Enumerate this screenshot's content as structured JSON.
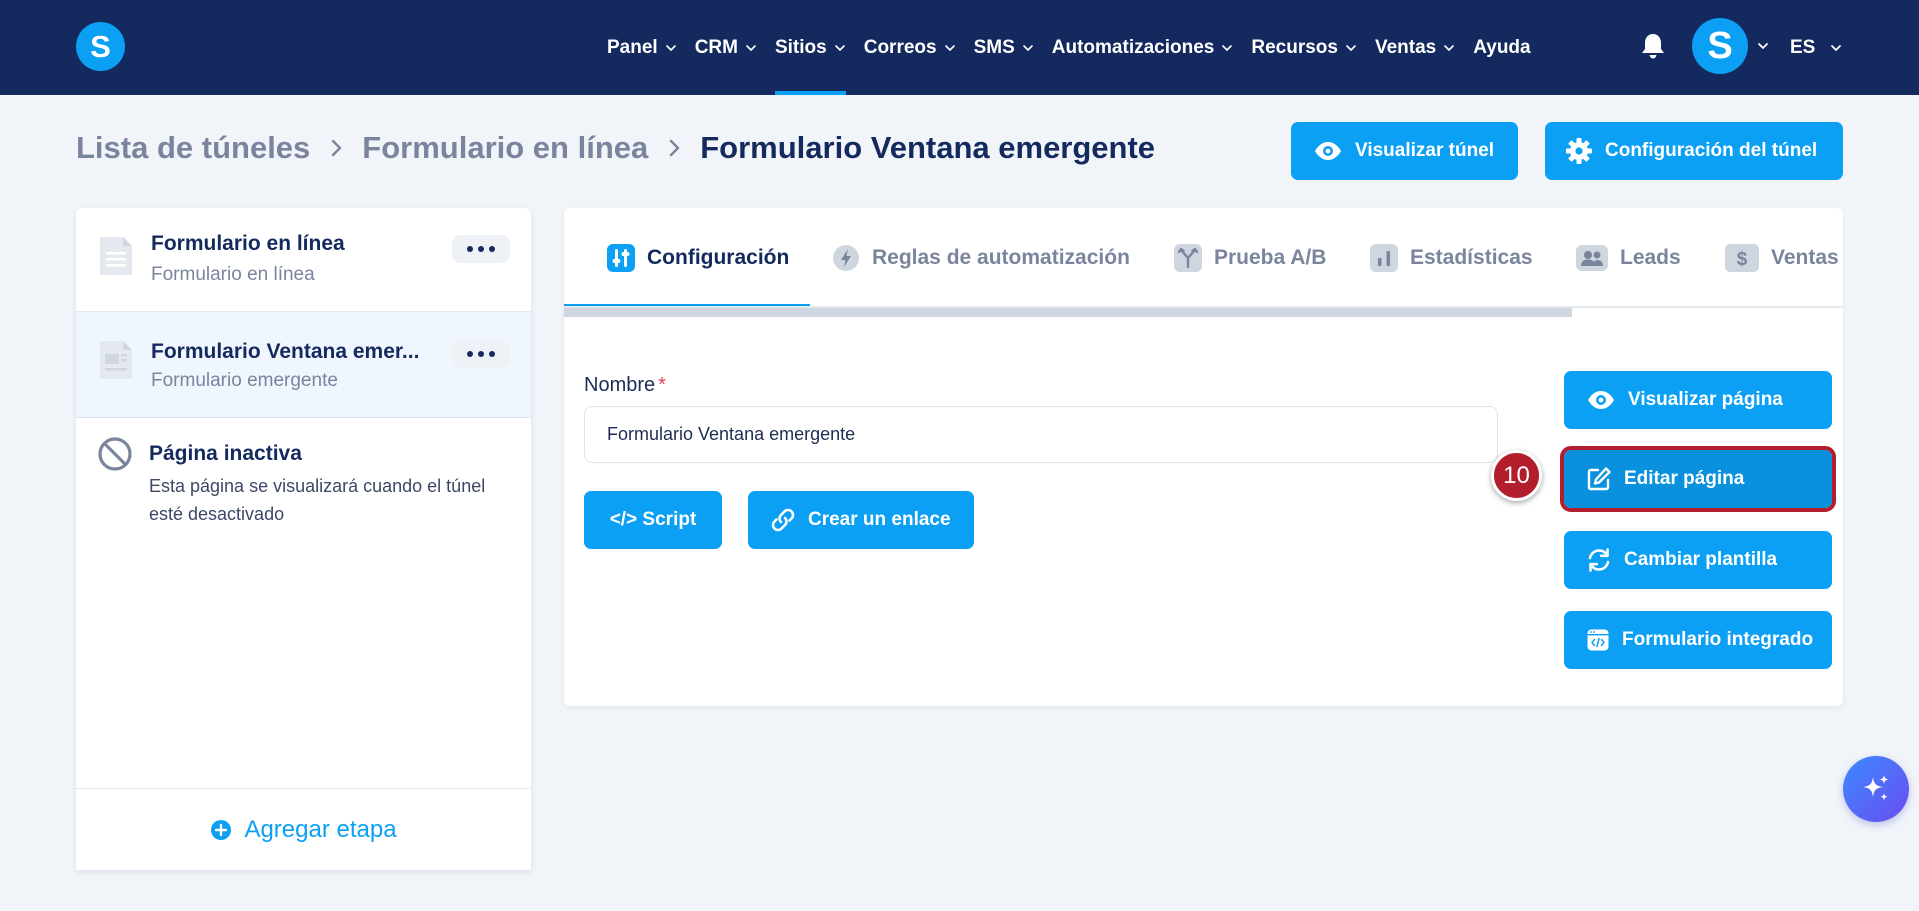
{
  "app": {
    "logo_letter": "S",
    "avatar_letter": "S"
  },
  "nav": {
    "items": [
      {
        "label": "Panel",
        "dropdown": true
      },
      {
        "label": "CRM",
        "dropdown": true
      },
      {
        "label": "Sitios",
        "dropdown": true,
        "active": true
      },
      {
        "label": "Correos",
        "dropdown": true
      },
      {
        "label": "SMS",
        "dropdown": true
      },
      {
        "label": "Automatizaciones",
        "dropdown": true
      },
      {
        "label": "Recursos",
        "dropdown": true
      },
      {
        "label": "Ventas",
        "dropdown": true
      },
      {
        "label": "Ayuda",
        "dropdown": false
      }
    ],
    "language": "ES"
  },
  "breadcrumb": {
    "items": [
      "Lista de túneles",
      "Formulario en línea",
      "Formulario Ventana emergente"
    ]
  },
  "header_actions": {
    "preview_tunnel": "Visualizar túnel",
    "tunnel_settings": "Configuración del túnel"
  },
  "steps": {
    "items": [
      {
        "title": "Formulario en línea",
        "subtitle": "Formulario en línea"
      },
      {
        "title": "Formulario Ventana emer...",
        "subtitle": "Formulario emergente"
      }
    ],
    "inactive": {
      "title": "Página inactiva",
      "description": "Esta página se visualizará cuando el túnel esté desactivado"
    },
    "add_label": "Agregar etapa"
  },
  "tabs": {
    "items": [
      {
        "label": "Configuración",
        "active": true
      },
      {
        "label": "Reglas de automatización"
      },
      {
        "label": "Prueba A/B"
      },
      {
        "label": "Estadísticas"
      },
      {
        "label": "Leads"
      },
      {
        "label": "Ventas"
      }
    ]
  },
  "form": {
    "name_label": "Nombre",
    "required_mark": "*",
    "name_value": "Formulario Ventana emergente",
    "script_button": "</> Script",
    "link_button": "Crear un enlace"
  },
  "page_actions": {
    "preview_page": "Visualizar página",
    "edit_page": "Editar página",
    "change_template": "Cambiar plantilla",
    "embedded_form": "Formulario integrado"
  },
  "step_badge": "10",
  "colors": {
    "navbar": "#14295e",
    "accent": "#0ca0f5",
    "highlight_border": "#b21e2b",
    "background": "#f1f4f9"
  }
}
